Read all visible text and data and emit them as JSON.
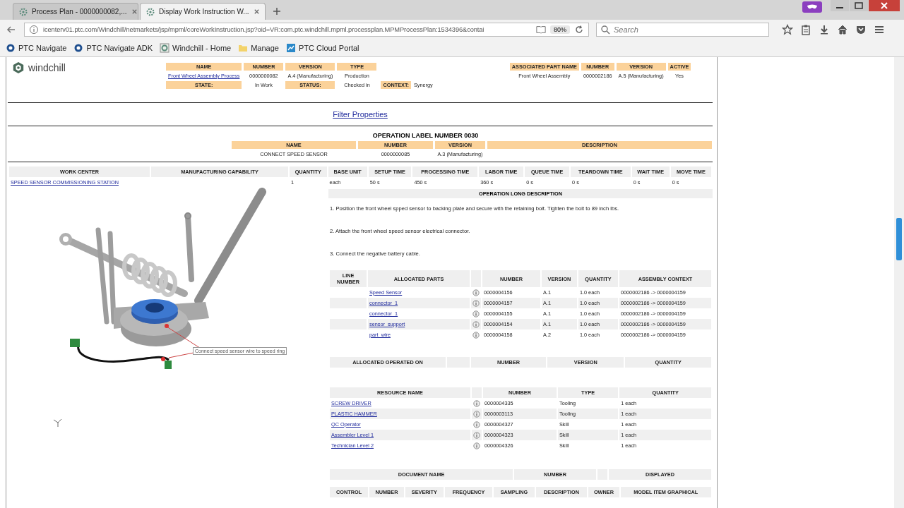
{
  "browser": {
    "tabs": [
      {
        "title": "Process Plan - 0000000082,...",
        "selected": false
      },
      {
        "title": "Display Work Instruction W...",
        "selected": true
      }
    ],
    "url": "icenterv01.ptc.com/Windchill/netmarkets/jsp/mpml/coreWorkInstruction.jsp?oid=VR:com.ptc.windchill.mpml.processplan.MPMProcessPlan:1534396&contai",
    "zoom": "80%",
    "search_placeholder": "Search",
    "bookmarks": [
      {
        "label": "PTC Navigate",
        "kind": "ring"
      },
      {
        "label": "PTC Navigate ADK",
        "kind": "ring"
      },
      {
        "label": "Windchill - Home",
        "kind": "gear"
      },
      {
        "label": "Manage",
        "kind": "folder"
      },
      {
        "label": "PTC Cloud Portal",
        "kind": "chart"
      }
    ]
  },
  "logo": "windchill",
  "plan": {
    "columns": [
      "NAME",
      "NUMBER",
      "VERSION",
      "TYPE"
    ],
    "values": [
      "Front Wheel Assembly Process",
      "0000000082",
      "A.4 (Manufacturing)",
      "Production"
    ],
    "fields": [
      {
        "label": "STATE:",
        "value": "In Work"
      },
      {
        "label": "STATUS:",
        "value": "Checked in"
      },
      {
        "label": "CONTEXT:",
        "value": "Synergy"
      }
    ]
  },
  "associated_part": {
    "columns": [
      "ASSOCIATED PART NAME",
      "NUMBER",
      "VERSION",
      "ACTIVE"
    ],
    "values": [
      "Front Wheel Assembly",
      "0000002186",
      "A.5 (Manufacturing)",
      "Yes"
    ]
  },
  "filter_link": "Filter Properties",
  "operation": {
    "title": "OPERATION LABEL NUMBER 0030",
    "columns": [
      "NAME",
      "NUMBER",
      "VERSION",
      "DESCRIPTION"
    ],
    "values": [
      "CONNECT SPEED SENSOR",
      "0000000085",
      "A.3 (Manufacturing)"
    ]
  },
  "work": {
    "columns": [
      "WORK CENTER",
      "MANUFACTURING CAPABILITY",
      "QUANTITY",
      "BASE UNIT",
      "SETUP TIME",
      "PROCESSING TIME",
      "LABOR TIME",
      "QUEUE TIME",
      "TEARDOWN TIME",
      "WAIT TIME",
      "MOVE TIME"
    ],
    "values": [
      "SPEED SENSOR COMMISSIONING STATION",
      "1",
      "each",
      "50 s",
      "450 s",
      "360 s",
      "0 s",
      "0 s",
      "0 s",
      "0 s"
    ]
  },
  "illustration": {
    "callout": "Connect speed sensor wire to speed ring"
  },
  "long_description": {
    "title": "OPERATION LONG DESCRIPTION",
    "steps": [
      "1. Position the front wheel spped sensor to backing plate and secure with the retaining bolt. Tighten the bolt to 89 inch lbs.",
      "2. Attach the front wheel speed sensor electrical connector.",
      "3. Connect the negative battery cable."
    ]
  },
  "allocated_parts": {
    "columns": [
      "LINE NUMBER",
      "ALLOCATED PARTS",
      "NUMBER",
      "VERSION",
      "QUANTITY",
      "ASSEMBLY CONTEXT"
    ],
    "rows": [
      {
        "name": "Speed Sensor",
        "number": "0000004156",
        "version": "A.1",
        "quantity": "1.0 each",
        "context": "0000002186 -> 0000004159"
      },
      {
        "name": "connector_1",
        "number": "0000004157",
        "version": "A.1",
        "quantity": "1.0 each",
        "context": "0000002186 -> 0000004159"
      },
      {
        "name": "connector_1",
        "number": "0000004155",
        "version": "A.1",
        "quantity": "1.0 each",
        "context": "0000002186 -> 0000004159"
      },
      {
        "name": "sensor_support",
        "number": "0000004154",
        "version": "A.1",
        "quantity": "1.0 each",
        "context": "0000002186 -> 0000004159"
      },
      {
        "name": "part_wire",
        "number": "0000004158",
        "version": "A.2",
        "quantity": "1.0 each",
        "context": "0000002186 -> 0000004159"
      }
    ]
  },
  "operated_on": {
    "columns": [
      "ALLOCATED OPERATED ON",
      "NUMBER",
      "VERSION",
      "QUANTITY"
    ]
  },
  "resources": {
    "columns": [
      "RESOURCE NAME",
      "NUMBER",
      "TYPE",
      "QUANTITY"
    ],
    "rows": [
      {
        "name": "SCREW DRIVER",
        "number": "0000004335",
        "type": "Tooling",
        "quantity": "1 each"
      },
      {
        "name": "PLASTIC HAMMER",
        "number": "0000003113",
        "type": "Tooling",
        "quantity": "1 each"
      },
      {
        "name": "QC Operator",
        "number": "0000004327",
        "type": "Skill",
        "quantity": "1 each"
      },
      {
        "name": "Assembler Level 1",
        "number": "0000004323",
        "type": "Skill",
        "quantity": "1 each"
      },
      {
        "name": "Technician Level 2",
        "number": "0000004326",
        "type": "Skill",
        "quantity": "1 each"
      }
    ]
  },
  "documents": {
    "columns": [
      "DOCUMENT NAME",
      "NUMBER",
      "DISPLAYED"
    ]
  },
  "characteristics": {
    "columns": [
      "CONTROL",
      "NUMBER",
      "SEVERITY",
      "FREQUENCY",
      "SAMPLING",
      "DESCRIPTION",
      "OWNER",
      "MODEL ITEM GRAPHICAL"
    ]
  }
}
